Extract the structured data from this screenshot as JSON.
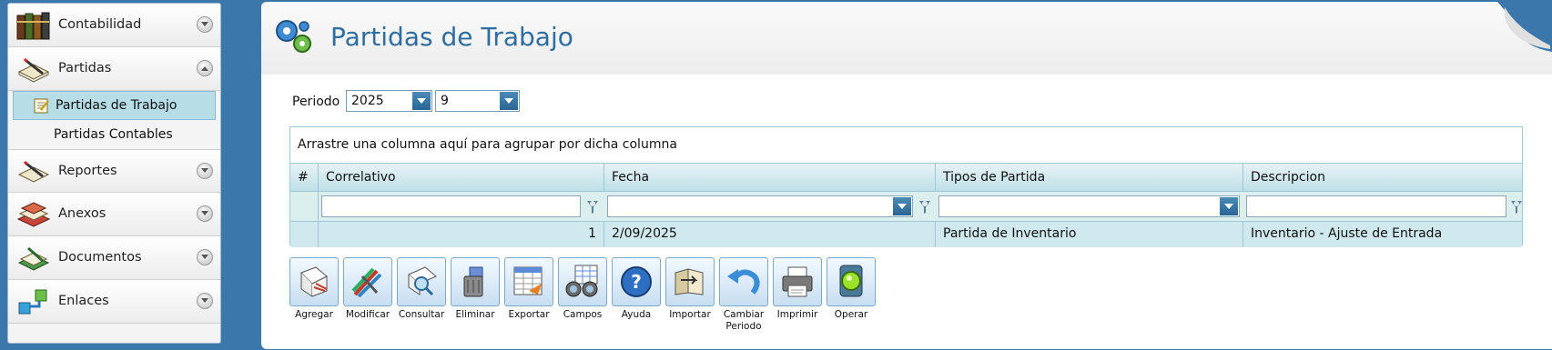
{
  "sidebar": {
    "groups": [
      {
        "label": "Contabilidad",
        "icon": "books-icon",
        "toggle": "expand"
      },
      {
        "label": "Partidas",
        "icon": "journal-pen-icon",
        "toggle": "collapse"
      },
      {
        "label": "Reportes",
        "icon": "report-pen-icon",
        "toggle": "expand"
      },
      {
        "label": "Anexos",
        "icon": "stacked-books-icon",
        "toggle": "expand"
      },
      {
        "label": "Documentos",
        "icon": "document-pen-icon",
        "toggle": "expand"
      },
      {
        "label": "Enlaces",
        "icon": "link-arrows-icon",
        "toggle": "expand"
      }
    ],
    "sub_items": [
      {
        "label": "Partidas de Trabajo",
        "active": true
      },
      {
        "label": "Partidas Contables",
        "active": false
      }
    ]
  },
  "header": {
    "title": "Partidas de Trabajo",
    "icon": "gears-icon"
  },
  "periodo": {
    "label": "Periodo",
    "year": "2025",
    "month": "9"
  },
  "grid": {
    "group_panel_text": "Arrastre una columna aquí para agrupar por dicha columna",
    "columns": [
      "#",
      "Correlativo",
      "Fecha",
      "Tipos de Partida",
      "Descripcion"
    ],
    "rows": [
      {
        "num": "",
        "correlativo": "1",
        "fecha": "2/09/2025",
        "tipo": "Partida de Inventario",
        "descripcion": "Inventario - Ajuste de Entrada"
      }
    ]
  },
  "toolbar": {
    "buttons": [
      {
        "label": "Agregar",
        "icon": "add-document-icon"
      },
      {
        "label": "Modificar",
        "icon": "edit-pencils-icon"
      },
      {
        "label": "Consultar",
        "icon": "magnifier-document-icon"
      },
      {
        "label": "Eliminar",
        "icon": "trash-icon"
      },
      {
        "label": "Exportar",
        "icon": "export-spreadsheet-icon"
      },
      {
        "label": "Campos",
        "icon": "binoculars-icon"
      },
      {
        "label": "Ayuda",
        "icon": "help-icon"
      },
      {
        "label": "Importar",
        "icon": "import-folder-icon"
      },
      {
        "label": "Cambiar Periodo",
        "icon": "undo-arrow-icon"
      },
      {
        "label": "Imprimir",
        "icon": "printer-icon"
      },
      {
        "label": "Operar",
        "icon": "traffic-light-icon"
      }
    ]
  },
  "colors": {
    "accent": "#2f6d9e",
    "background": "#3b77ab",
    "grid_header": "#bfe0e8",
    "row": "#cfe9ee",
    "active_item": "#b7dde6"
  }
}
